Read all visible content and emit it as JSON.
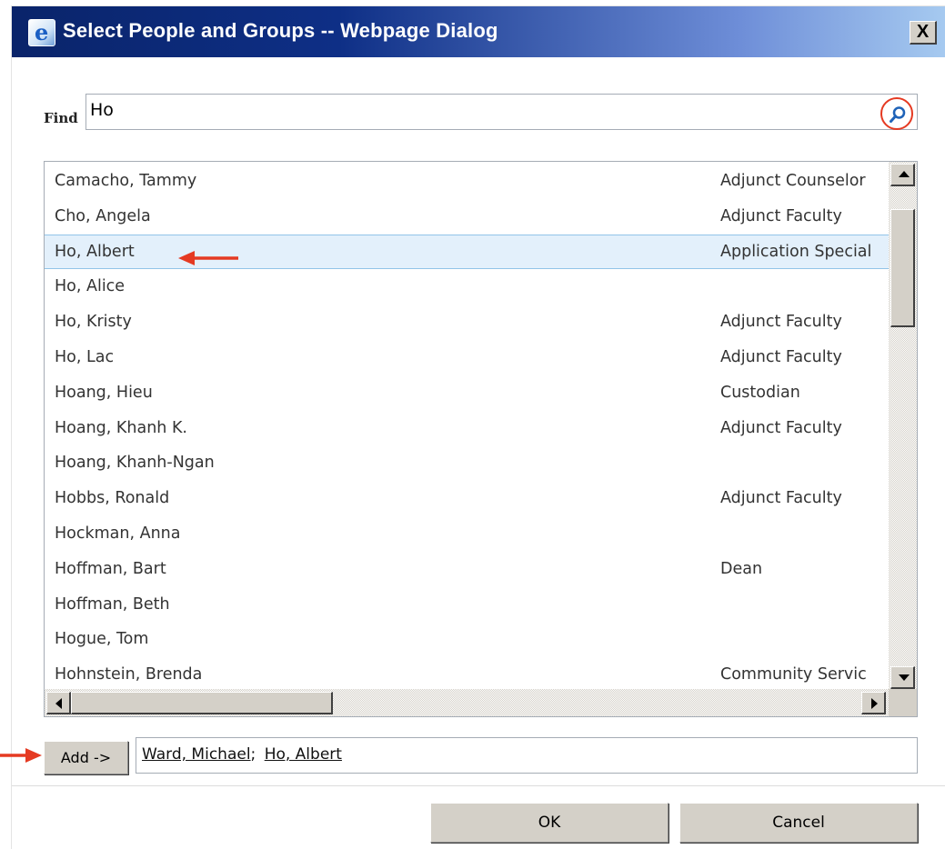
{
  "window": {
    "title": "Select People and Groups -- Webpage Dialog",
    "close_glyph": "X"
  },
  "find": {
    "label": "Find",
    "value": "Ho",
    "search_icon": "search-icon"
  },
  "results": [
    {
      "name": "Camacho, Tammy",
      "title": "Adjunct Counselor"
    },
    {
      "name": "Cho, Angela",
      "title": "Adjunct Faculty"
    },
    {
      "name": "Ho, Albert",
      "title": "Application Special"
    },
    {
      "name": "Ho, Alice",
      "title": ""
    },
    {
      "name": "Ho, Kristy",
      "title": "Adjunct Faculty"
    },
    {
      "name": "Ho, Lac",
      "title": "Adjunct Faculty"
    },
    {
      "name": "Hoang, Hieu",
      "title": "Custodian"
    },
    {
      "name": "Hoang, Khanh K.",
      "title": "Adjunct Faculty"
    },
    {
      "name": "Hoang, Khanh-Ngan",
      "title": ""
    },
    {
      "name": "Hobbs, Ronald",
      "title": "Adjunct Faculty"
    },
    {
      "name": "Hockman, Anna",
      "title": ""
    },
    {
      "name": "Hoffman, Bart",
      "title": "Dean"
    },
    {
      "name": "Hoffman, Beth",
      "title": ""
    },
    {
      "name": "Hogue, Tom",
      "title": ""
    },
    {
      "name": "Hohnstein, Brenda",
      "title": "Community Servic"
    }
  ],
  "selected_result": "Ho, Albert",
  "add_button": {
    "label": "Add ->"
  },
  "picked": {
    "people": [
      "Ward, Michael",
      "Ho, Albert"
    ],
    "separator": ";"
  },
  "footer": {
    "ok_label": "OK",
    "cancel_label": "Cancel"
  },
  "colors": {
    "titlebar_start": "#0a246a",
    "titlebar_end": "#a6caf0",
    "selected_row": "#e3f0fb",
    "annotation_red": "#e53a22"
  }
}
